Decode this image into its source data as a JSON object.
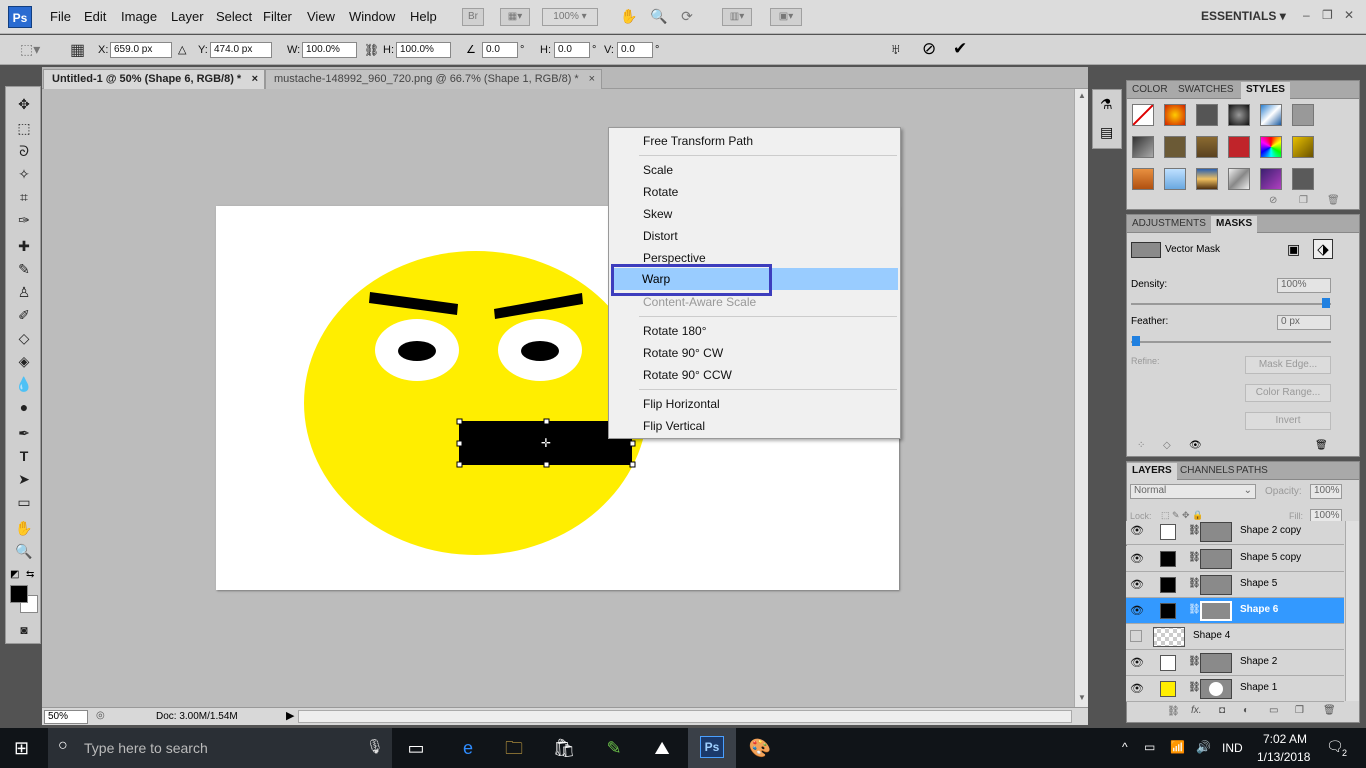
{
  "app": {
    "logo": "Ps",
    "workspace": "ESSENTIALS",
    "zoom_display": "100%"
  },
  "menu": [
    "File",
    "Edit",
    "Image",
    "Layer",
    "Select",
    "Filter",
    "View",
    "Window",
    "Help"
  ],
  "menu_icons": {
    "bridge": "Br"
  },
  "options": {
    "x_label": "X:",
    "x_value": "659.0 px",
    "y_label": "Y:",
    "y_value": "474.0 px",
    "w_label": "W:",
    "w_value": "100.0%",
    "h_label": "H:",
    "h_value": "100.0%",
    "angle_value": "0.0",
    "angle_unit": "°",
    "hskew_label": "H:",
    "hskew_value": "0.0",
    "hskew_unit": "°",
    "vskew_label": "V:",
    "vskew_value": "0.0",
    "vskew_unit": "°"
  },
  "tabs": [
    {
      "label": "Untitled-1 @ 50% (Shape 6, RGB/8) *",
      "active": true
    },
    {
      "label": "mustache-148992_960_720.png @ 66.7% (Shape 1, RGB/8) *",
      "active": false
    }
  ],
  "tab_close": "×",
  "context_menu": {
    "items": [
      {
        "label": "Free Transform Path"
      },
      {
        "label": "Scale"
      },
      {
        "label": "Rotate"
      },
      {
        "label": "Skew"
      },
      {
        "label": "Distort"
      },
      {
        "label": "Perspective"
      },
      {
        "label": "Warp",
        "highlighted": true
      },
      {
        "label": "Content-Aware Scale",
        "disabled": true
      },
      {
        "label": "Rotate 180°"
      },
      {
        "label": "Rotate 90° CW"
      },
      {
        "label": "Rotate 90° CCW"
      },
      {
        "label": "Flip Horizontal"
      },
      {
        "label": "Flip Vertical"
      }
    ]
  },
  "status": {
    "zoom": "50%",
    "doc": "Doc: 3.00M/1.54M"
  },
  "panels": {
    "styles_tabs": [
      "COLOR",
      "SWATCHES",
      "STYLES"
    ],
    "masks_tabs": [
      "ADJUSTMENTS",
      "MASKS"
    ],
    "masks": {
      "vector_mask": "Vector Mask",
      "density_label": "Density:",
      "density_value": "100%",
      "feather_label": "Feather:",
      "feather_value": "0 px",
      "refine_label": "Refine:",
      "mask_edge": "Mask Edge...",
      "color_range": "Color Range...",
      "invert": "Invert"
    },
    "layers_tabs": [
      "LAYERS",
      "CHANNELS",
      "PATHS"
    ],
    "layers": {
      "blend_mode": "Normal",
      "opacity_label": "Opacity:",
      "opacity_value": "100%",
      "lock_label": "Lock:",
      "fill_label": "Fill:",
      "fill_value": "100%",
      "rows": [
        {
          "name": "Shape 2 copy",
          "swatch": "#ffffff",
          "visible": true,
          "selected": false
        },
        {
          "name": "Shape 5 copy",
          "swatch": "#000000",
          "visible": true,
          "selected": false
        },
        {
          "name": "Shape 5",
          "swatch": "#000000",
          "visible": true,
          "selected": false
        },
        {
          "name": "Shape 6",
          "swatch": "#000000",
          "visible": true,
          "selected": true
        },
        {
          "name": "Shape 4",
          "swatch": "checker",
          "visible": false,
          "selected": false
        },
        {
          "name": "Shape 2",
          "swatch": "#ffffff",
          "visible": true,
          "selected": false
        },
        {
          "name": "Shape 1",
          "swatch": "#ffee00",
          "visible": true,
          "selected": false
        }
      ]
    }
  },
  "taskbar": {
    "search_placeholder": "Type here to search",
    "lang": "IND",
    "time": "7:02 AM",
    "date": "1/13/2018",
    "notifications": "2"
  },
  "colors": {
    "accent": "#3399ff",
    "highlight_box": "#3d3dbd",
    "face": "#ffee00"
  }
}
